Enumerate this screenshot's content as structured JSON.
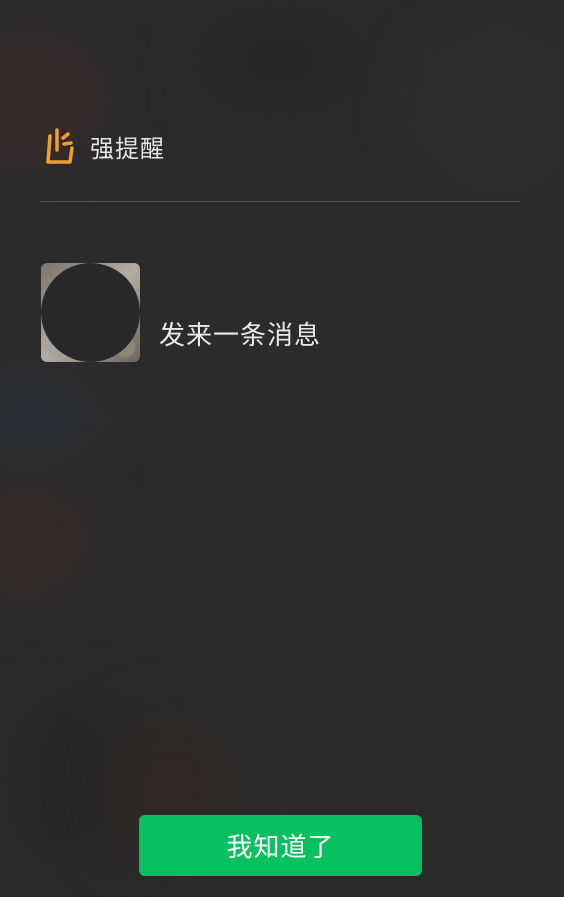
{
  "header": {
    "icon": "alert-hand-icon",
    "title": "强提醒"
  },
  "notification": {
    "avatar": "sender-avatar",
    "message": "发来一条消息"
  },
  "actions": {
    "acknowledge_label": "我知道了"
  },
  "colors": {
    "accent_icon": "#f0a030",
    "button_green": "#07c160",
    "background": "#2a2a2a"
  }
}
